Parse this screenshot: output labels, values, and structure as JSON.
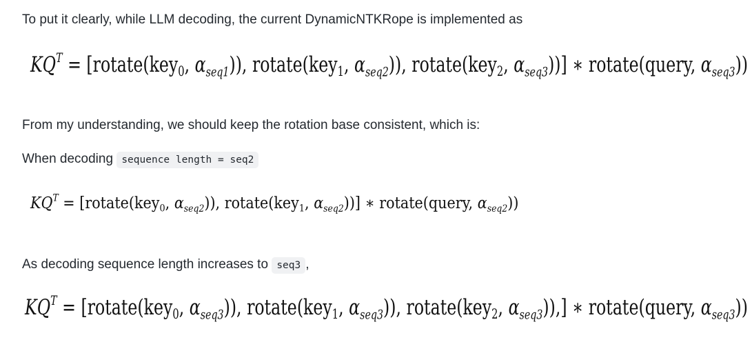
{
  "paragraphs": {
    "intro": "To put it clearly, while LLM decoding, the current DynamicNTKRope is implemented as",
    "understanding": "From my understanding, we should keep the rotation base consistent, which is:",
    "when_prefix": "When decoding",
    "when_code": "sequence length = seq2",
    "as_prefix": "As decoding sequence length increases to",
    "as_code": "seq3",
    "as_suffix": ","
  },
  "equations": {
    "eq1": {
      "lhs_K": "K",
      "lhs_Q": "Q",
      "lhs_T": "T",
      "eq": " = ",
      "open": "[",
      "t0_fn": "rotate(key",
      "t0_idx": "0",
      "t0_sep": ", ",
      "t0_sub": "seq1",
      "t0_close": ")),",
      "t1_fn": " rotate(key",
      "t1_idx": "1",
      "t1_sep": ", ",
      "t1_sub": "seq2",
      "t1_close": ")),",
      "t2_fn": " rotate(key",
      "t2_idx": "2",
      "t2_sep": ", ",
      "t2_sub": "seq3",
      "t2_close": "))]",
      "mult": " ∗ ",
      "q_fn": "rotate(query, ",
      "q_sub": "seq3",
      "q_close": "))"
    },
    "eq2": {
      "lhs_K": "K",
      "lhs_Q": "Q",
      "lhs_T": "T",
      "eq": " = ",
      "open": "[",
      "t0_fn": "rotate(key",
      "t0_idx": "0",
      "t0_sep": ", ",
      "t0_sub": "seq2",
      "t0_close": ")),",
      "t1_fn": " rotate(key",
      "t1_idx": "1",
      "t1_sep": ", ",
      "t1_sub": "seq2",
      "t1_close": "))]",
      "mult": " ∗ ",
      "q_fn": "rotate(query, ",
      "q_sub": "seq2",
      "q_close": "))"
    },
    "eq3": {
      "lhs_K": "K",
      "lhs_Q": "Q",
      "lhs_T": "T",
      "eq": " = ",
      "open": "[",
      "t0_fn": "rotate(key",
      "t0_idx": "0",
      "t0_sep": ", ",
      "t0_sub": "seq3",
      "t0_close": ")),",
      "t1_fn": " rotate(key",
      "t1_idx": "1",
      "t1_sep": ", ",
      "t1_sub": "seq3",
      "t1_close": ")),",
      "t2_fn": " rotate(key",
      "t2_idx": "2",
      "t2_sep": ", ",
      "t2_sub": "seq3",
      "t2_close": ")),]",
      "mult": " ∗ ",
      "q_fn": "rotate(query, ",
      "q_sub": "seq3",
      "q_close": "))"
    },
    "alpha": "α"
  }
}
